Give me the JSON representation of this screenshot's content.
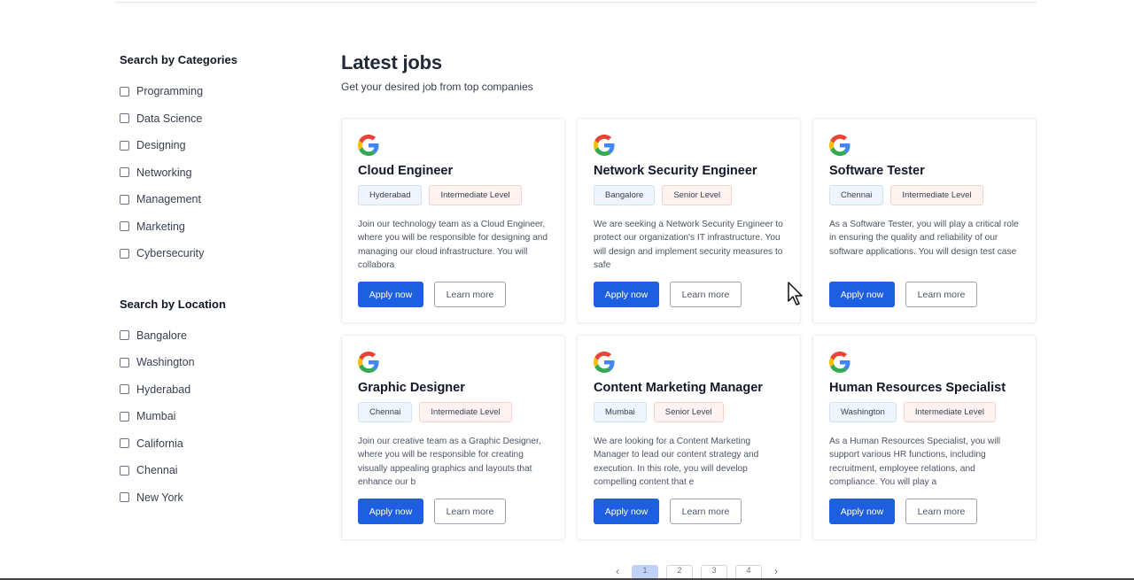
{
  "sidebar": {
    "categories_heading": "Search by Categories",
    "categories": [
      "Programming",
      "Data Science",
      "Designing",
      "Networking",
      "Management",
      "Marketing",
      "Cybersecurity"
    ],
    "location_heading": "Search by Location",
    "locations": [
      "Bangalore",
      "Washington",
      "Hyderabad",
      "Mumbai",
      "California",
      "Chennai",
      "New York"
    ]
  },
  "main": {
    "title": "Latest jobs",
    "subtitle": "Get your desired job from top companies"
  },
  "jobs": [
    {
      "title": "Cloud Engineer",
      "location": "Hyderabad",
      "level": "Intermediate Level",
      "description": "Join our technology team as a Cloud Engineer, where you will be responsible for designing and managing our cloud infrastructure. You will collabora",
      "apply": "Apply now",
      "learn": "Learn more",
      "logo": "google-logo"
    },
    {
      "title": "Network Security Engineer",
      "location": "Bangalore",
      "level": "Senior Level",
      "description": "We are seeking a Network Security Engineer to protect our organization's IT infrastructure. You will design and implement security measures to safe",
      "apply": "Apply now",
      "learn": "Learn more",
      "logo": "google-logo"
    },
    {
      "title": "Software Tester",
      "location": "Chennai",
      "level": "Intermediate Level",
      "description": "As a Software Tester, you will play a critical role in ensuring the quality and reliability of our software applications. You will design test case",
      "apply": "Apply now",
      "learn": "Learn more",
      "logo": "google-logo"
    },
    {
      "title": "Graphic Designer",
      "location": "Chennai",
      "level": "Intermediate Level",
      "description": "Join our creative team as a Graphic Designer, where you will be responsible for creating visually appealing graphics and layouts that enhance our b",
      "apply": "Apply now",
      "learn": "Learn more",
      "logo": "google-logo"
    },
    {
      "title": "Content Marketing Manager",
      "location": "Mumbai",
      "level": "Senior Level",
      "description": "We are looking for a Content Marketing Manager to lead our content strategy and execution. In this role, you will develop compelling content that e",
      "apply": "Apply now",
      "learn": "Learn more",
      "logo": "google-logo"
    },
    {
      "title": "Human Resources Specialist",
      "location": "Washington",
      "level": "Intermediate Level",
      "description": "As a Human Resources Specialist, you will support various HR functions, including recruitment, employee relations, and compliance. You will play a",
      "apply": "Apply now",
      "learn": "Learn more",
      "logo": "google-logo"
    }
  ],
  "pagination": {
    "prev": "‹",
    "pages": [
      "1",
      "2",
      "3",
      "4"
    ],
    "next": "›",
    "active_page": "1"
  },
  "colors": {
    "primary": "#1d5fe0",
    "location_tag_bg": "#eef5fd",
    "level_tag_bg": "#fff3f2"
  }
}
